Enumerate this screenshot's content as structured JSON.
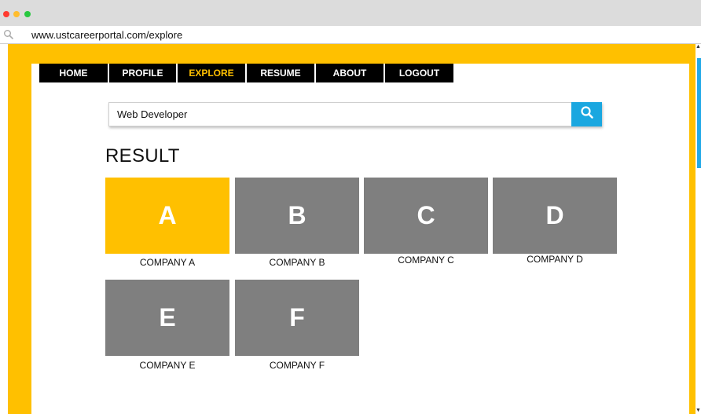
{
  "browser": {
    "url": "www.ustcareerportal.com/explore"
  },
  "nav": {
    "items": [
      {
        "label": "HOME"
      },
      {
        "label": "PROFILE"
      },
      {
        "label": "EXPLORE"
      },
      {
        "label": "RESUME"
      },
      {
        "label": "ABOUT"
      },
      {
        "label": "LOGOUT"
      }
    ],
    "active": "EXPLORE"
  },
  "search": {
    "value": "Web Developer",
    "icon": "search-icon"
  },
  "results": {
    "title": "RESULT",
    "companies": [
      {
        "letter": "A",
        "name": "COMPANY A",
        "highlighted": true
      },
      {
        "letter": "B",
        "name": "COMPANY B",
        "highlighted": false
      },
      {
        "letter": "C",
        "name": "COMPANY C",
        "highlighted": false
      },
      {
        "letter": "D",
        "name": "COMPANY D",
        "highlighted": false
      },
      {
        "letter": "E",
        "name": "COMPANY E",
        "highlighted": false
      },
      {
        "letter": "F",
        "name": "COMPANY F",
        "highlighted": false
      }
    ]
  },
  "colors": {
    "brand_yellow": "#ffc000",
    "tile_gray": "#7f7f7f",
    "search_blue": "#1aa7e0",
    "nav_black": "#000000"
  }
}
